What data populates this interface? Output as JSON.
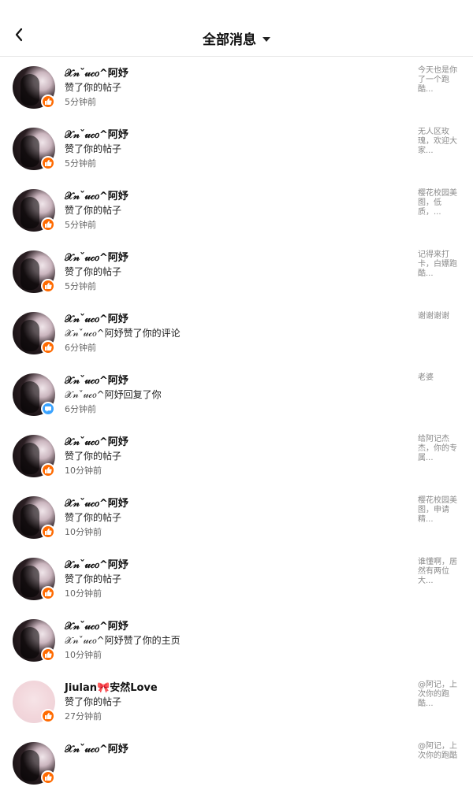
{
  "header": {
    "title": "全部消息"
  },
  "messages": [
    {
      "name": "𝒳𝓃ˇ𝓊𝒸𝑜^阿妤",
      "action": "赞了你的帖子",
      "time": "5分钟前",
      "preview": "今天也是你了一个跑酷...",
      "badge": "like"
    },
    {
      "name": "𝒳𝓃ˇ𝓊𝒸𝑜^阿妤",
      "action": "赞了你的帖子",
      "time": "5分钟前",
      "preview": "无人区玫瑰，欢迎大家...",
      "badge": "like"
    },
    {
      "name": "𝒳𝓃ˇ𝓊𝒸𝑜^阿妤",
      "action": "赞了你的帖子",
      "time": "5分钟前",
      "preview": "樱花校园美图，低质，...",
      "badge": "like"
    },
    {
      "name": "𝒳𝓃ˇ𝓊𝒸𝑜^阿妤",
      "action": "赞了你的帖子",
      "time": "5分钟前",
      "preview": "记得来打卡，白嫖跑酷...",
      "badge": "like"
    },
    {
      "name": "𝒳𝓃ˇ𝓊𝒸𝑜^阿妤",
      "action": "𝒳𝓃ˇ𝓊𝒸𝑜^阿妤赞了你的评论",
      "time": "6分钟前",
      "preview": "谢谢谢谢",
      "badge": "like"
    },
    {
      "name": "𝒳𝓃ˇ𝓊𝒸𝑜^阿妤",
      "action": "𝒳𝓃ˇ𝓊𝒸𝑜^阿妤回复了你",
      "time": "6分钟前",
      "preview": "老婆",
      "badge": "comment"
    },
    {
      "name": "𝒳𝓃ˇ𝓊𝒸𝑜^阿妤",
      "action": "赞了你的帖子",
      "time": "10分钟前",
      "preview": "给阿记杰杰，你的专属...",
      "badge": "like"
    },
    {
      "name": "𝒳𝓃ˇ𝓊𝒸𝑜^阿妤",
      "action": "赞了你的帖子",
      "time": "10分钟前",
      "preview": "樱花校园美图，申请精...",
      "badge": "like"
    },
    {
      "name": "𝒳𝓃ˇ𝓊𝒸𝑜^阿妤",
      "action": "赞了你的帖子",
      "time": "10分钟前",
      "preview": "谁懂啊，居然有两位大...",
      "badge": "like"
    },
    {
      "name": "𝒳𝓃ˇ𝓊𝒸𝑜^阿妤",
      "action": "𝒳𝓃ˇ𝓊𝒸𝑜^阿妤赞了你的主页",
      "time": "10分钟前",
      "preview": "",
      "badge": "like"
    },
    {
      "name": "Jiulan🎀安然Love",
      "action": "赞了你的帖子",
      "time": "27分钟前",
      "preview": "@阿记，上次你的跑酷...",
      "badge": "like",
      "avatar": "plain"
    },
    {
      "name": "𝒳𝓃ˇ𝓊𝒸𝑜^阿妤",
      "action": "",
      "time": "",
      "preview": "@阿记，上次你的跑酷",
      "badge": "like"
    }
  ]
}
